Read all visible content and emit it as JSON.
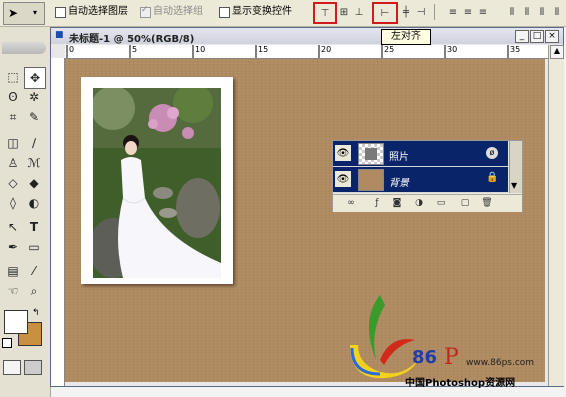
{
  "options_bar": {
    "auto_select_layer": {
      "label": "自动选择图层",
      "checked": false
    },
    "auto_select_group": {
      "label": "自动选择组",
      "checked": true,
      "disabled": true
    },
    "show_transform_controls": {
      "label": "显示变换控件",
      "checked": false
    }
  },
  "document": {
    "title": "未标题-1 @ 50%(RGB/8)",
    "ruler_labels": [
      "0",
      "5",
      "10",
      "15",
      "20",
      "25",
      "30",
      "35"
    ]
  },
  "tooltip": "左对齐",
  "layers": [
    {
      "name": "照片",
      "italic": false
    },
    {
      "name": "背景",
      "italic": true
    }
  ],
  "watermark": {
    "number": "86",
    "url": "www.86ps.com",
    "caption": "中国Photoshop资源网"
  },
  "colors": {
    "canvas": "#b08a60",
    "layer_selected": "#0a246a",
    "highlight_box": "#d21a1a",
    "foreground": "#ffffff",
    "background": "#c89040"
  }
}
